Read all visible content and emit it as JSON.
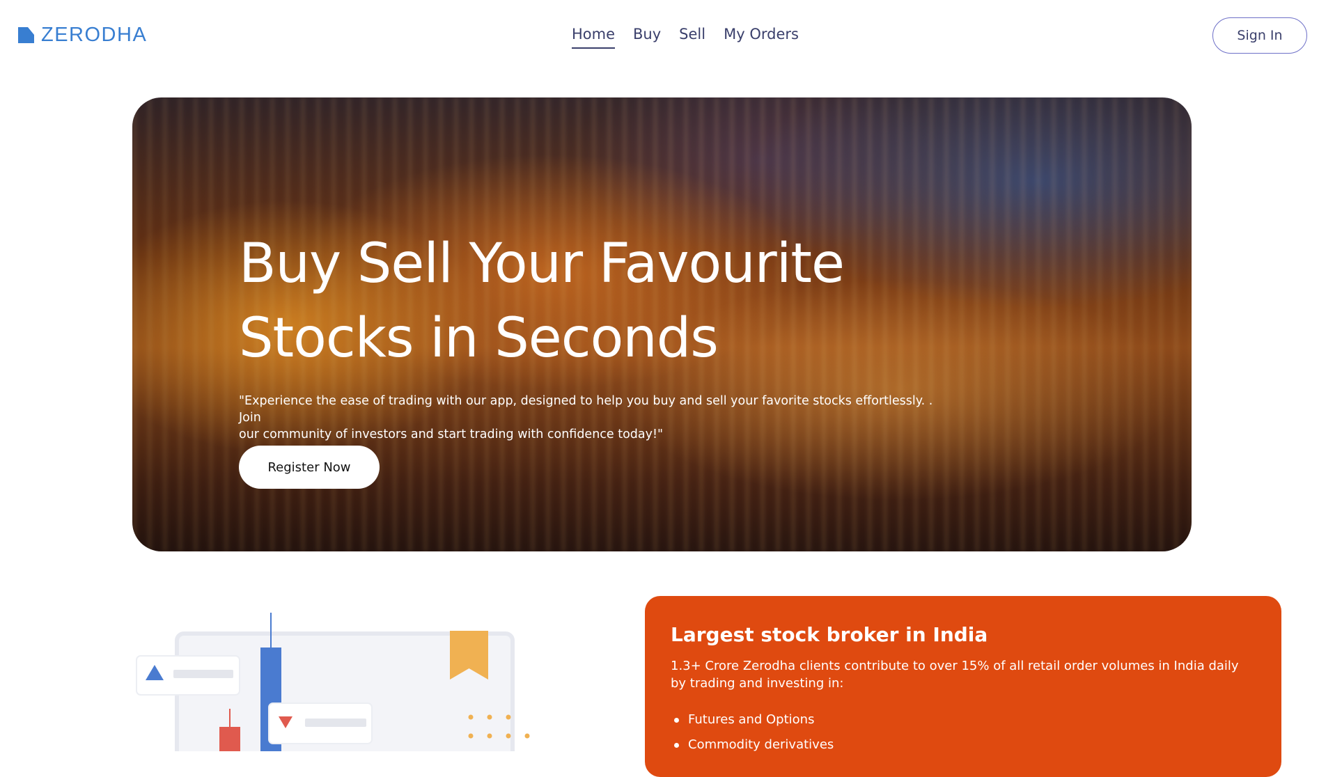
{
  "brand": {
    "name": "ZERODHA",
    "color": "#387ed1"
  },
  "nav": {
    "items": [
      {
        "label": "Home",
        "active": true
      },
      {
        "label": "Buy",
        "active": false
      },
      {
        "label": "Sell",
        "active": false
      },
      {
        "label": "My Orders",
        "active": false
      }
    ],
    "sign_in_label": "Sign In"
  },
  "hero": {
    "title_line1": "Buy Sell Your Favourite",
    "title_line2": "Stocks in Seconds",
    "description_line1": "\"Experience the ease of trading with our app, designed to help you buy and sell your favorite stocks effortlessly. . Join",
    "description_line2": "our community of investors and start trading with confidence today!\"",
    "cta_label": "Register Now"
  },
  "info_card": {
    "title": "Largest stock broker in India",
    "description": "1.3+ Crore Zerodha clients contribute to over 15% of all retail order volumes in India daily by trading and investing in:",
    "items": [
      "Futures and Options",
      "Commodity derivatives"
    ],
    "background_color": "#df4a10"
  },
  "colors": {
    "nav_text": "#3a3f6b",
    "sign_in_border": "#6d6fc7",
    "illustration_blue": "#4a7bd0",
    "illustration_red": "#e05a4e",
    "illustration_gold": "#f0b152"
  }
}
